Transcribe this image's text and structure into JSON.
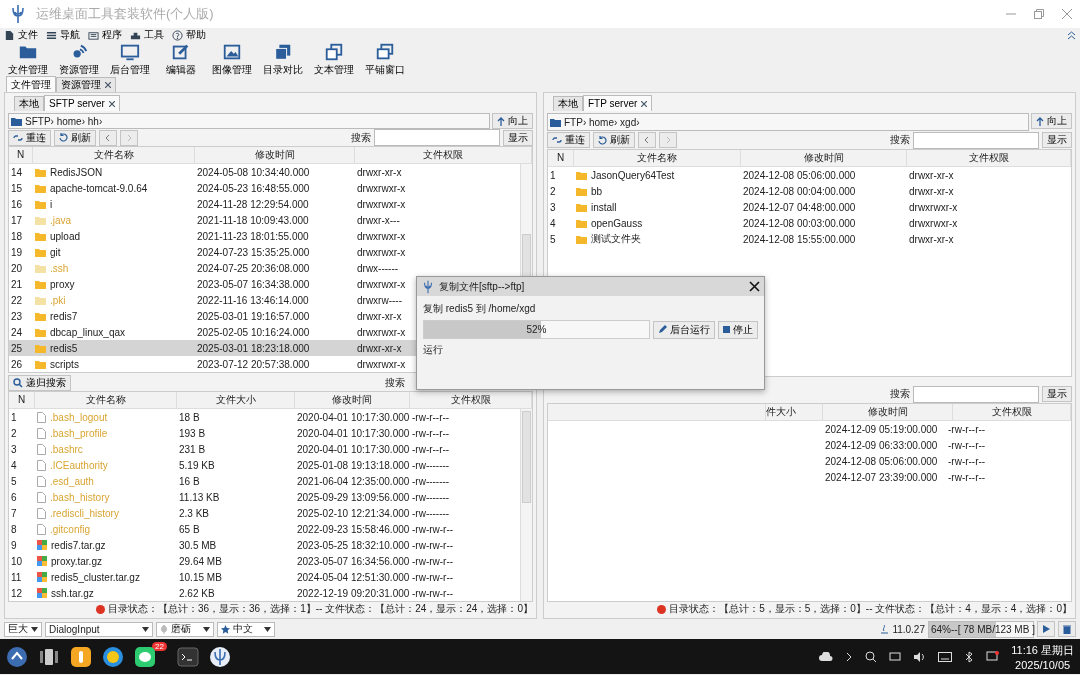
{
  "window": {
    "title": "运维桌面工具套装软件(个人版)"
  },
  "menu": [
    "文件",
    "导航",
    "程序",
    "工具",
    "帮助"
  ],
  "toolbar": [
    "文件管理",
    "资源管理",
    "后台管理",
    "编辑器",
    "图像管理",
    "目录对比",
    "文本管理",
    "平铺窗口"
  ],
  "main_tabs": [
    {
      "label": "文件管理",
      "selected": true,
      "closable": false
    },
    {
      "label": "资源管理",
      "selected": false,
      "closable": true
    }
  ],
  "left": {
    "tabs": [
      {
        "label": "本地",
        "selected": false,
        "closable": false
      },
      {
        "label": "SFTP server",
        "selected": true,
        "closable": true
      }
    ],
    "path": "SFTP› home› hh›",
    "up": "向上",
    "reconnect": "重连",
    "refresh": "刷新",
    "search_label": "搜索",
    "show": "显示",
    "dir_table": {
      "columns": [
        "N",
        "文件名称",
        "修改时间",
        "文件权限"
      ],
      "rows": [
        {
          "n": "14",
          "name": "RedisJSON",
          "modified": "2024-05-08 10:34:40.000",
          "perms": "drwxr-xr-x",
          "hidden": false,
          "selected": false
        },
        {
          "n": "15",
          "name": "apache-tomcat-9.0.64",
          "modified": "2024-05-23 16:48:55.000",
          "perms": "drwxrwxr-x",
          "hidden": false,
          "selected": false
        },
        {
          "n": "16",
          "name": "i",
          "modified": "2024-11-28 12:29:54.000",
          "perms": "drwxrwxr-x",
          "hidden": false,
          "selected": false
        },
        {
          "n": "17",
          "name": ".java",
          "modified": "2021-11-18 10:09:43.000",
          "perms": "drwxr-x---",
          "hidden": true,
          "selected": false
        },
        {
          "n": "18",
          "name": "upload",
          "modified": "2021-11-23 18:01:55.000",
          "perms": "drwxrwxr-x",
          "hidden": false,
          "selected": false
        },
        {
          "n": "19",
          "name": "git",
          "modified": "2024-07-23 15:35:25.000",
          "perms": "drwxrwxr-x",
          "hidden": false,
          "selected": false
        },
        {
          "n": "20",
          "name": ".ssh",
          "modified": "2024-07-25 20:36:08.000",
          "perms": "drwx------",
          "hidden": true,
          "selected": false
        },
        {
          "n": "21",
          "name": "proxy",
          "modified": "2023-05-07 16:34:38.000",
          "perms": "drwxrwxr-x",
          "hidden": false,
          "selected": false
        },
        {
          "n": "22",
          "name": ".pki",
          "modified": "2022-11-16 13:46:14.000",
          "perms": "drwxrw----",
          "hidden": true,
          "selected": false
        },
        {
          "n": "23",
          "name": "redis7",
          "modified": "2025-03-01 19:16:57.000",
          "perms": "drwxr-xr-x",
          "hidden": false,
          "selected": false
        },
        {
          "n": "24",
          "name": "dbcap_linux_qax",
          "modified": "2025-02-05 10:16:24.000",
          "perms": "drwxrwxr-x",
          "hidden": false,
          "selected": false
        },
        {
          "n": "25",
          "name": "redis5",
          "modified": "2025-03-01 18:23:18.000",
          "perms": "drwxr-xr-x",
          "hidden": false,
          "selected": true
        },
        {
          "n": "26",
          "name": "scripts",
          "modified": "2023-07-12 20:57:38.000",
          "perms": "drwxrwxr-x",
          "hidden": false,
          "selected": false
        }
      ]
    },
    "recursive_search": "递归搜索",
    "search_label_2": "搜索",
    "file_table": {
      "columns": [
        "N",
        "文件名称",
        "文件大小",
        "修改时间",
        "文件权限"
      ],
      "rows": [
        {
          "n": "1",
          "name": ".bash_logout",
          "size": "18 B",
          "modified": "2020-04-01 10:17:30.000",
          "perms": "-rw-r--r--",
          "kind": "file",
          "hidden": true,
          "selected": false
        },
        {
          "n": "2",
          "name": ".bash_profile",
          "size": "193 B",
          "modified": "2020-04-01 10:17:30.000",
          "perms": "-rw-r--r--",
          "kind": "file",
          "hidden": true,
          "selected": false
        },
        {
          "n": "3",
          "name": ".bashrc",
          "size": "231 B",
          "modified": "2020-04-01 10:17:30.000",
          "perms": "-rw-r--r--",
          "kind": "file",
          "hidden": true,
          "selected": false
        },
        {
          "n": "4",
          "name": ".ICEauthority",
          "size": "5.19 KB",
          "modified": "2025-01-08 19:13:18.000",
          "perms": "-rw-------",
          "kind": "file",
          "hidden": true,
          "selected": false
        },
        {
          "n": "5",
          "name": ".esd_auth",
          "size": "16 B",
          "modified": "2021-06-04 12:35:00.000",
          "perms": "-rw-------",
          "kind": "file",
          "hidden": true,
          "selected": false
        },
        {
          "n": "6",
          "name": ".bash_history",
          "size": "11.13 KB",
          "modified": "2025-09-29 13:09:56.000",
          "perms": "-rw-------",
          "kind": "file",
          "hidden": true,
          "selected": false
        },
        {
          "n": "7",
          "name": ".rediscli_history",
          "size": "2.3 KB",
          "modified": "2025-02-10 12:21:34.000",
          "perms": "-rw-------",
          "kind": "file",
          "hidden": true,
          "selected": false
        },
        {
          "n": "8",
          "name": ".gitconfig",
          "size": "65 B",
          "modified": "2022-09-23 15:58:46.000",
          "perms": "-rw-rw-r--",
          "kind": "file",
          "hidden": true,
          "selected": false
        },
        {
          "n": "9",
          "name": "redis7.tar.gz",
          "size": "30.5 MB",
          "modified": "2023-05-25 18:32:10.000",
          "perms": "-rw-rw-r--",
          "kind": "archive",
          "hidden": false,
          "selected": false
        },
        {
          "n": "10",
          "name": "proxy.tar.gz",
          "size": "29.64 MB",
          "modified": "2023-05-07 16:34:56.000",
          "perms": "-rw-rw-r--",
          "kind": "archive",
          "hidden": false,
          "selected": false
        },
        {
          "n": "11",
          "name": "redis5_cluster.tar.gz",
          "size": "10.15 MB",
          "modified": "2024-05-04 12:51:30.000",
          "perms": "-rw-rw-r--",
          "kind": "archive",
          "hidden": false,
          "selected": false
        },
        {
          "n": "12",
          "name": "ssh.tar.gz",
          "size": "2.62 KB",
          "modified": "2022-12-19 09:20:31.000",
          "perms": "-rw-rw-r--",
          "kind": "archive",
          "hidden": false,
          "selected": false
        }
      ]
    },
    "status": "目录状态：【总计：36，显示：36，选择：1】-- 文件状态：【总计：24，显示：24，选择：0】"
  },
  "right": {
    "tabs": [
      {
        "label": "本地",
        "selected": false,
        "closable": false
      },
      {
        "label": "FTP server",
        "selected": true,
        "closable": true
      }
    ],
    "path": "FTP› home› xgd›",
    "up": "向上",
    "reconnect": "重连",
    "refresh": "刷新",
    "search_label": "搜索",
    "show": "显示",
    "dir_table": {
      "columns": [
        "N",
        "文件名称",
        "修改时间",
        "文件权限"
      ],
      "rows": [
        {
          "n": "1",
          "name": "JasonQuery64Test",
          "modified": "2024-12-08 05:06:00.000",
          "perms": "drwxr-xr-x",
          "hidden": false,
          "selected": false
        },
        {
          "n": "2",
          "name": "bb",
          "modified": "2024-12-08 00:04:00.000",
          "perms": "drwxr-xr-x",
          "hidden": false,
          "selected": false
        },
        {
          "n": "3",
          "name": "install",
          "modified": "2024-12-07 04:48:00.000",
          "perms": "drwxrwxr-x",
          "hidden": false,
          "selected": false
        },
        {
          "n": "4",
          "name": "openGauss",
          "modified": "2024-12-08 00:03:00.000",
          "perms": "drwxrwxr-x",
          "hidden": false,
          "selected": false
        },
        {
          "n": "5",
          "name": "测试文件夹",
          "modified": "2024-12-08 15:55:00.000",
          "perms": "drwxr-xr-x",
          "hidden": false,
          "selected": false
        }
      ]
    },
    "search_label_2": "搜索",
    "show_2": "显示",
    "file_table": {
      "columns": [
        "件大小",
        "修改时间",
        "文件权限"
      ],
      "rows": [
        {
          "modified": "2024-12-09 05:19:00.000",
          "perms": "-rw-r--r--"
        },
        {
          "modified": "2024-12-09 06:33:00.000",
          "perms": "-rw-r--r--"
        },
        {
          "modified": "2024-12-08 05:06:00.000",
          "perms": "-rw-r--r--"
        },
        {
          "modified": "2024-12-07 23:39:00.000",
          "perms": "-rw-r--r--"
        }
      ]
    },
    "status": "目录状态：【总计：5，显示：5，选择：0】-- 文件状态：【总计：4，显示：4，选择：0】"
  },
  "dialog": {
    "title": "复制文件[sftp-->ftp]",
    "message": "复制 redis5 到 /home/xgd",
    "level": 0.52,
    "percent": "52%",
    "background": "后台运行",
    "stop": "停止",
    "state": "运行"
  },
  "bottom_bar": {
    "font_size": "巨大",
    "font": "DialogInput",
    "theme": "磨砺",
    "language": "中文",
    "version": "11.0.27",
    "memory": {
      "text": "64%--[ 78 MB/123 MB ]",
      "level": 0.64
    }
  },
  "taskbar": {
    "badge": "22",
    "time": "11:16 星期日",
    "date": "2025/10/05"
  }
}
